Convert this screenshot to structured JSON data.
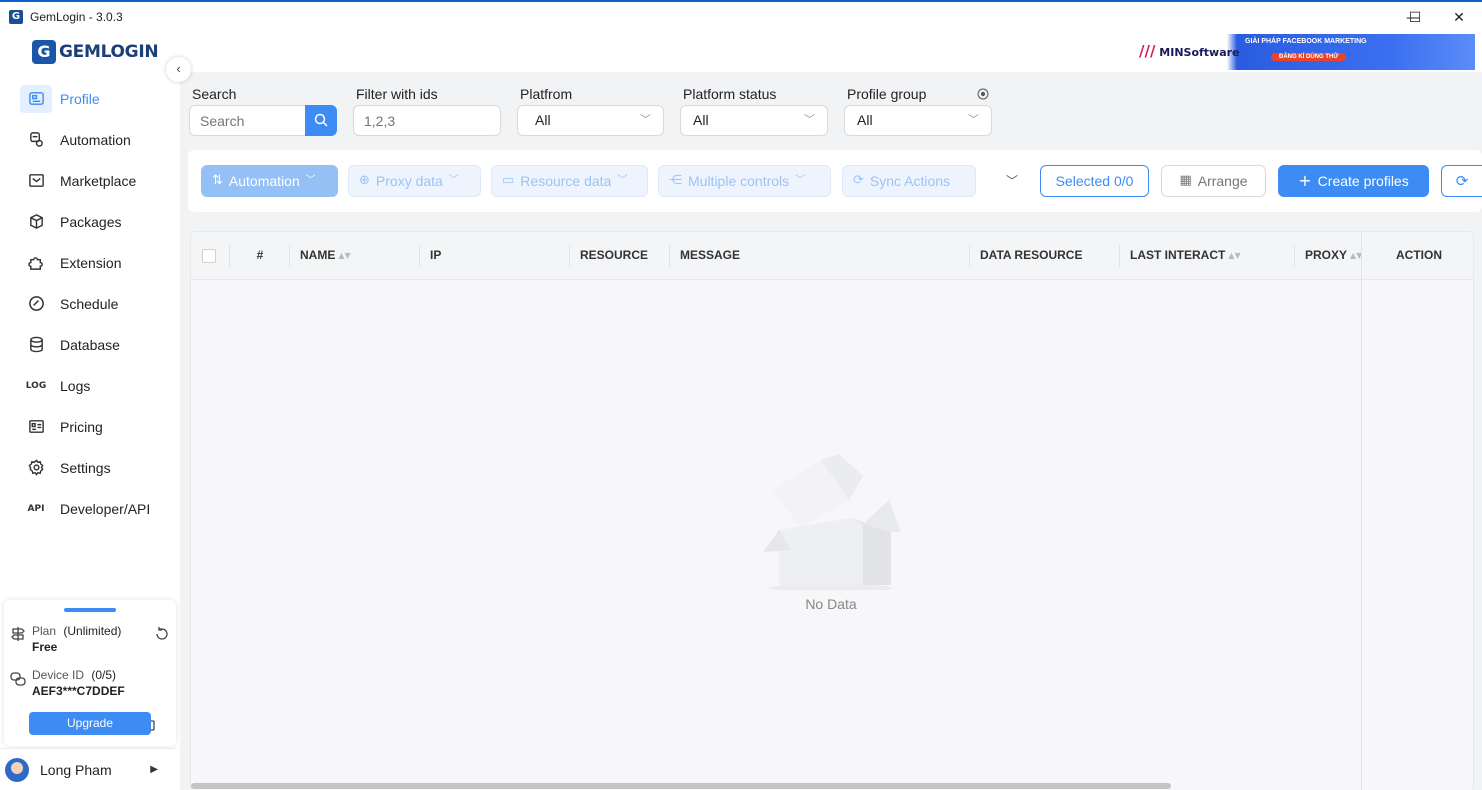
{
  "window": {
    "title": "GemLogin - 3.0.3",
    "controls": {
      "minimize": "—",
      "maximize": "☐",
      "close": "✕"
    }
  },
  "brand": {
    "mark": "G",
    "word": "GEMLOGIN"
  },
  "sidebar": {
    "items": [
      {
        "label": "Profile",
        "icon": "profile-icon",
        "active": true
      },
      {
        "label": "Automation",
        "icon": "automation-icon"
      },
      {
        "label": "Marketplace",
        "icon": "marketplace-icon"
      },
      {
        "label": "Packages",
        "icon": "package-icon"
      },
      {
        "label": "Extension",
        "icon": "puzzle-icon"
      },
      {
        "label": "Schedule",
        "icon": "schedule-icon"
      },
      {
        "label": "Database",
        "icon": "database-icon"
      },
      {
        "label": "Logs",
        "icon": "logs-icon",
        "glyph": "LOG"
      },
      {
        "label": "Pricing",
        "icon": "pricing-icon"
      },
      {
        "label": "Settings",
        "icon": "gear-icon"
      },
      {
        "label": "Developer/API",
        "icon": "api-icon",
        "glyph": "API"
      }
    ],
    "plan": {
      "plan_label": "Plan",
      "plan_detail": "(Unlimited)",
      "plan_value": "Free",
      "device_label": "Device ID",
      "device_count": "(0/5)",
      "device_value": "AEF3***C7DDEF",
      "upgrade_label": "Upgrade"
    },
    "user": {
      "name": "Long Pham"
    }
  },
  "banner": {
    "brand": "MINSoftware",
    "headline": "GIẢI PHÁP FACEBOOK MARKETING",
    "cta": "ĐĂNG KÍ DÙNG THỬ"
  },
  "filters": {
    "search": {
      "label": "Search",
      "placeholder": "Search"
    },
    "ids": {
      "label": "Filter with ids",
      "placeholder": "1,2,3"
    },
    "platform": {
      "label": "Platfrom",
      "value": "All"
    },
    "platform_status": {
      "label": "Platform status",
      "value": "All"
    },
    "profile_group": {
      "label": "Profile group",
      "value": "All"
    }
  },
  "toolbar": {
    "automation": "Automation",
    "proxy_data": "Proxy data",
    "resource_data": "Resource data",
    "multiple_controls": "Multiple controls",
    "sync_actions": "Sync Actions",
    "selected": "Selected 0/0",
    "arrange": "Arrange",
    "create_profiles": "Create profiles"
  },
  "table": {
    "columns": [
      "#",
      "NAME",
      "IP",
      "RESOURCE",
      "MESSAGE",
      "DATA RESOURCE",
      "LAST INTERACT",
      "PROXY",
      "ACTION"
    ],
    "empty_text": "No Data"
  },
  "colors": {
    "accent": "#3c8cf4",
    "brand": "#1b57a6"
  }
}
